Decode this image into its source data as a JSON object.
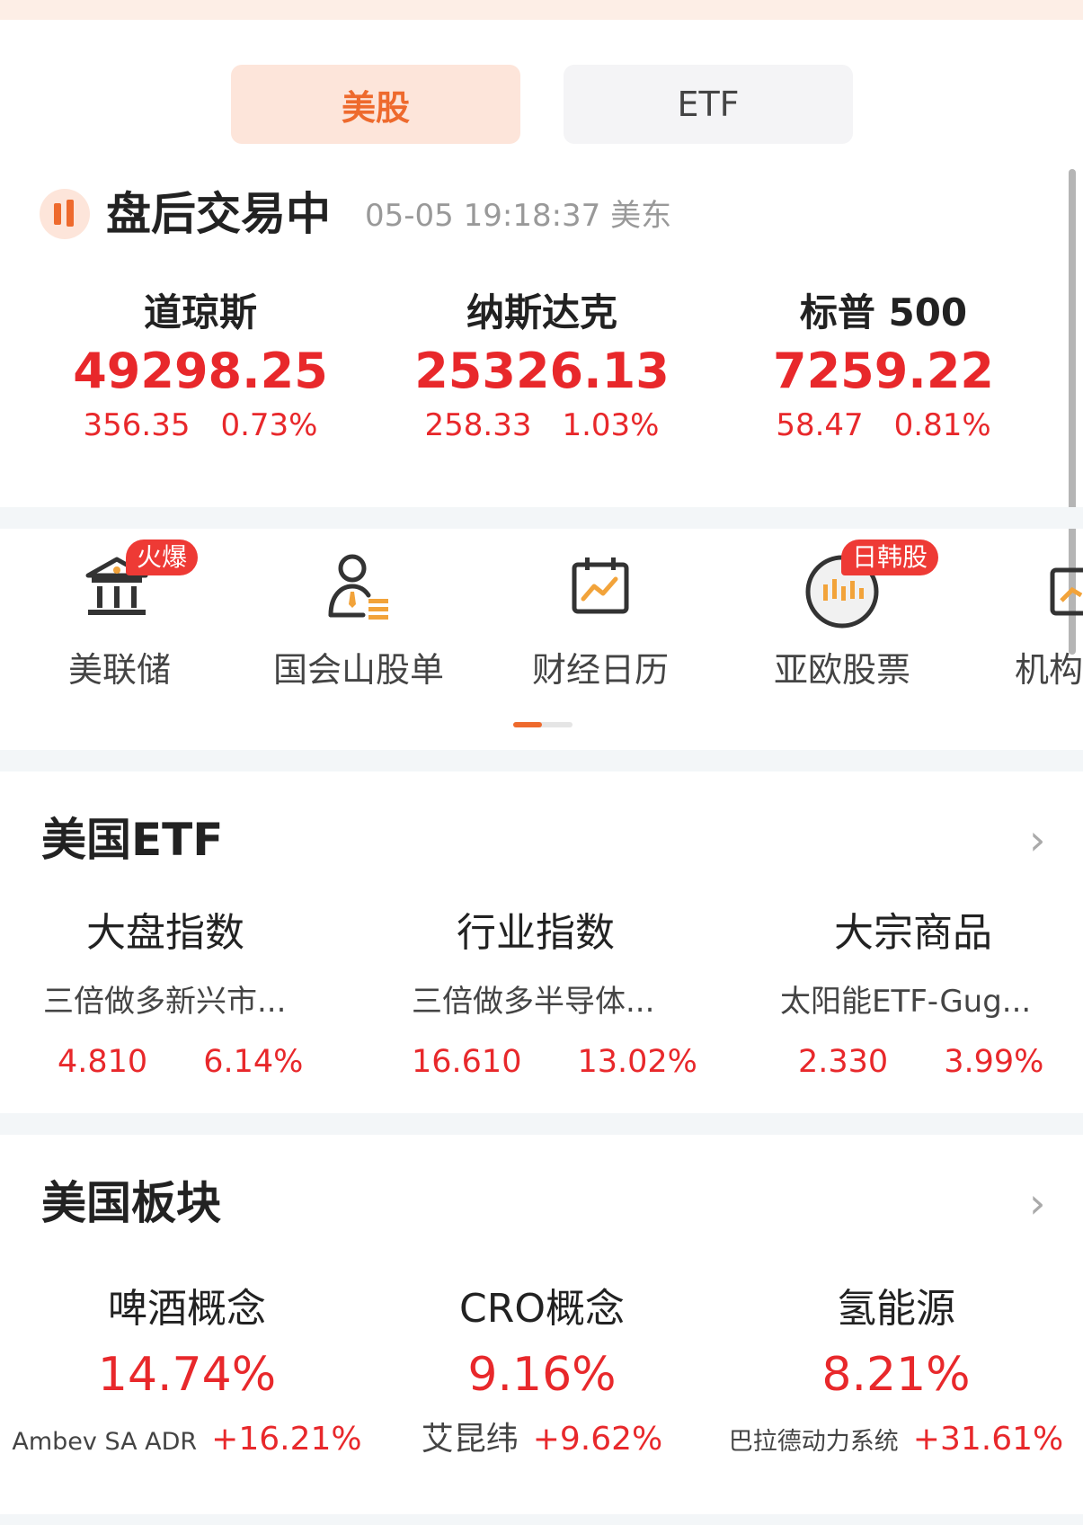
{
  "tabs": [
    {
      "label": "美股",
      "active": true
    },
    {
      "label": "ETF",
      "active": false
    }
  ],
  "status": {
    "title": "盘后交易中",
    "time": "05-05 19:18:37 美东"
  },
  "indices": [
    {
      "name": "道琼斯",
      "value": "49298.25",
      "change": "356.35",
      "percent": "0.73%"
    },
    {
      "name": "纳斯达克",
      "value": "25326.13",
      "change": "258.33",
      "percent": "1.03%"
    },
    {
      "name": "标普 500",
      "value": "7259.22",
      "change": "58.47",
      "percent": "0.81%"
    }
  ],
  "shortcuts": [
    {
      "label": "美联储",
      "badge": "火爆",
      "icon": "bank-icon"
    },
    {
      "label": "国会山股单",
      "badge": "",
      "icon": "person-list-icon"
    },
    {
      "label": "财经日历",
      "badge": "",
      "icon": "calendar-chart-icon"
    },
    {
      "label": "亚欧股票",
      "badge": "日韩股",
      "icon": "globe-candlestick-icon"
    },
    {
      "label": "机构",
      "badge": "",
      "icon": "monitor-chart-icon"
    }
  ],
  "etf_section": {
    "title": "美国ETF",
    "items": [
      {
        "category": "大盘指数",
        "name": "三倍做多新兴市...",
        "price": "4.810",
        "percent": "6.14%"
      },
      {
        "category": "行业指数",
        "name": "三倍做多半导体...",
        "price": "16.610",
        "percent": "13.02%"
      },
      {
        "category": "大宗商品",
        "name": "太阳能ETF-Gug...",
        "price": "2.330",
        "percent": "3.99%"
      }
    ]
  },
  "sector_section": {
    "title": "美国板块",
    "items": [
      {
        "name": "啤酒概念",
        "percent": "14.74%",
        "leader": "Ambev SA ADR",
        "leader_pct": "+16.21%"
      },
      {
        "name": "CRO概念",
        "percent": "9.16%",
        "leader": "艾昆纬",
        "leader_pct": "+9.62%"
      },
      {
        "name": "氢能源",
        "percent": "8.21%",
        "leader": "巴拉德动力系统",
        "leader_pct": "+31.61%"
      }
    ]
  },
  "colors": {
    "accent": "#ee6a2d",
    "up": "#e8282b",
    "badge": "#ee3a35"
  }
}
